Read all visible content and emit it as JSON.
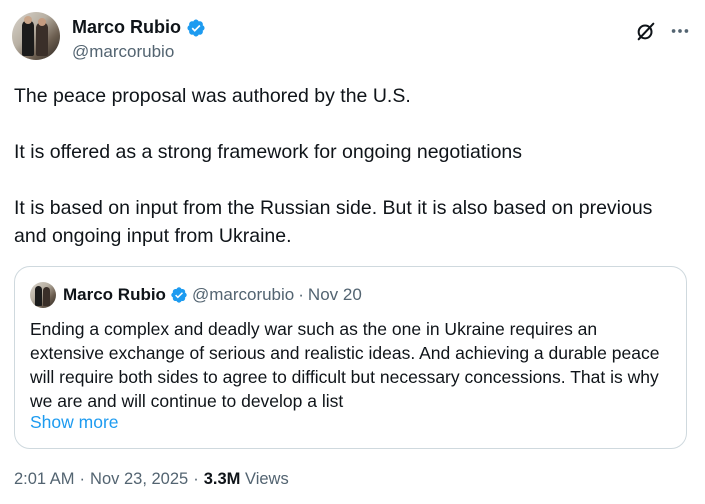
{
  "author": {
    "display_name": "Marco Rubio",
    "handle": "@marcorubio"
  },
  "icons": {
    "verified": "verified-badge-icon",
    "grok": "grok-icon",
    "more": "more-options-icon"
  },
  "colors": {
    "verified_blue": "#1d9bf0",
    "link_blue": "#1d9bf0",
    "secondary_text": "#536471",
    "border": "#cfd9de"
  },
  "tweet": {
    "line1": "The peace proposal was authored by the U.S.",
    "line2": "It is offered as a strong framework for ongoing negotiations",
    "line3": "It is based on input from the Russian side. But it is also based on previous and ongoing input from Ukraine."
  },
  "quote": {
    "display_name": "Marco Rubio",
    "handle": "@marcorubio",
    "separator": "·",
    "date": "Nov 20",
    "text": "Ending a complex and deadly war such as the one in Ukraine requires an extensive exchange of serious and realistic ideas. And achieving a durable peace will require both sides to agree to difficult but necessary concessions. That is why we are and will continue to develop a list",
    "show_more": "Show more"
  },
  "meta": {
    "time": "2:01 AM",
    "separator": "·",
    "date": "Nov 23, 2025",
    "views_count": "3.3M",
    "views_label": "Views"
  }
}
